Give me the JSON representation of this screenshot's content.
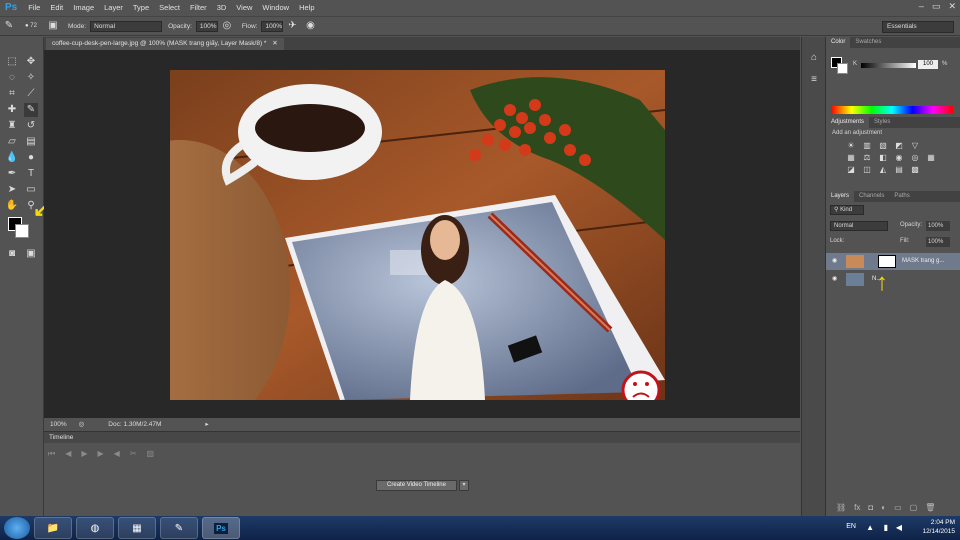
{
  "menubar": {
    "logo": "Ps",
    "items": [
      "File",
      "Edit",
      "Image",
      "Layer",
      "Type",
      "Select",
      "Filter",
      "3D",
      "View",
      "Window",
      "Help"
    ],
    "window_controls": [
      "–",
      "▭",
      "✕"
    ]
  },
  "options": {
    "brush_size": "72",
    "mode_label": "Mode:",
    "mode_value": "Normal",
    "opacity_label": "Opacity:",
    "opacity_value": "100%",
    "flow_label": "Flow:",
    "flow_value": "100%",
    "workspace": "Essentials"
  },
  "document": {
    "tab_title": "coffee-cup-desk-pen-large.jpg @ 100% (MASK trang giấy, Layer Mask/8) *",
    "zoom": "100%",
    "doc_size": "Doc: 1.30M/2.47M"
  },
  "timeline": {
    "title": "Timeline",
    "create_button": "Create Video Timeline"
  },
  "color_panel": {
    "tabs": [
      "Color",
      "Swatches"
    ],
    "channel": "K",
    "value": "100",
    "unit": "%"
  },
  "adjustments_panel": {
    "tabs": [
      "Adjustments",
      "Styles"
    ],
    "heading": "Add an adjustment"
  },
  "layers_panel": {
    "tabs": [
      "Layers",
      "Channels",
      "Paths"
    ],
    "filter_kind": "Kind",
    "blend_mode": "Normal",
    "opacity_label": "Opacity:",
    "opacity_value": "100%",
    "lock_label": "Lock:",
    "fill_label": "Fill:",
    "fill_value": "100%",
    "layers": [
      {
        "name": "MASK trang g..."
      },
      {
        "name": "N..."
      }
    ]
  },
  "taskbar": {
    "lang": "EN",
    "time": "2:04 PM",
    "date": "12/14/2015"
  }
}
